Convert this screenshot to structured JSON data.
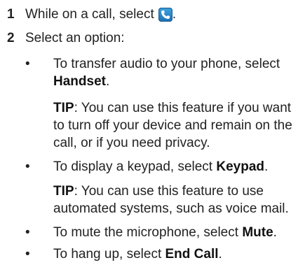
{
  "steps": [
    {
      "number": "1",
      "text": "While on a call, select"
    },
    {
      "number": "2",
      "text": "Select an option:"
    }
  ],
  "bullet_char": "•",
  "options": [
    {
      "text": "To transfer audio to your phone, select ",
      "bold": "Handset",
      "end": "."
    },
    {
      "text": "To display a keypad, select ",
      "bold": "Keypad",
      "end": "."
    },
    {
      "text": "To mute the microphone, select ",
      "bold": "Mute",
      "end": "."
    },
    {
      "text": "To hang up, select ",
      "bold": "End Call",
      "end": "."
    }
  ],
  "tips": [
    {
      "label": "TIP",
      "text": ": You can use this feature if you want to turn off your device and remain on the call, or if you need privacy."
    },
    {
      "label": "TIP",
      "text": ": You can use this feature to use automated systems, such as voice mail."
    }
  ],
  "phone_icon": "phone-handset-icon",
  "colors": {
    "icon_blue": "#2a8fd0",
    "text": "#222222"
  }
}
